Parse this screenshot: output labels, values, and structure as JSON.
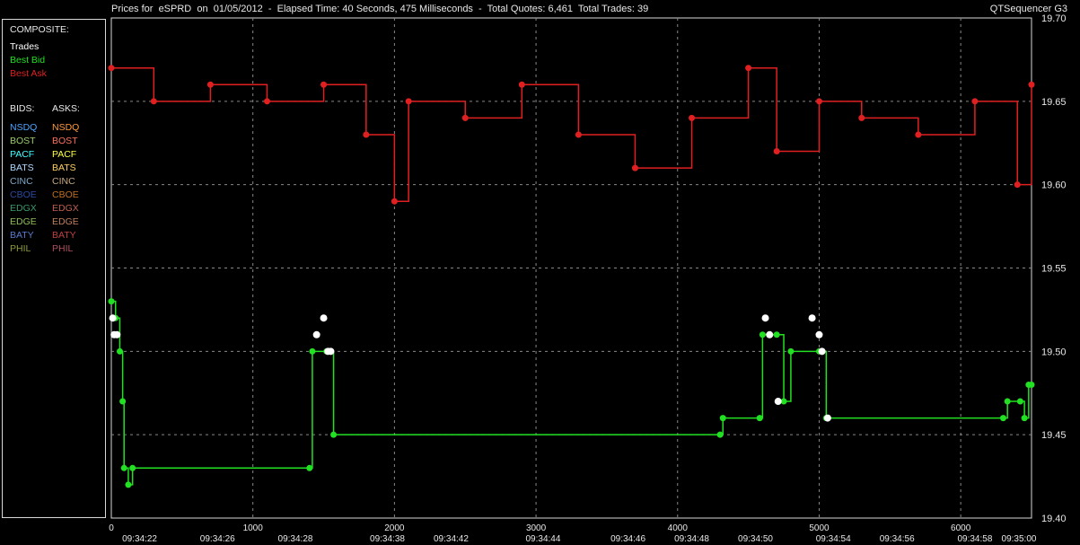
{
  "header": {
    "title": "Prices for  eSPRD  on  01/05/2012  -  Elapsed Time: 40 Seconds, 475 Milliseconds  -  Total Quotes: 6,461  Total Trades: 39",
    "app_name": "QTSequencer G3"
  },
  "legend": {
    "composite_title": "COMPOSITE:",
    "composite_items": [
      {
        "label": "Trades",
        "color": "#ffffff"
      },
      {
        "label": "Best Bid",
        "color": "#22e022"
      },
      {
        "label": "Best Ask",
        "color": "#e02020"
      }
    ],
    "bids_title": "BIDS:",
    "asks_title": "ASKS:",
    "bids": [
      {
        "label": "NSDQ",
        "color": "#4fa3ff"
      },
      {
        "label": "BOST",
        "color": "#9ccc6b"
      },
      {
        "label": "PACF",
        "color": "#40ffff"
      },
      {
        "label": "BATS",
        "color": "#b0d8ff"
      },
      {
        "label": "CINC",
        "color": "#7fa8c8"
      },
      {
        "label": "CBOE",
        "color": "#2a4aa0"
      },
      {
        "label": "EDGX",
        "color": "#3a9a6a"
      },
      {
        "label": "EDGE",
        "color": "#8fbf5a"
      },
      {
        "label": "BATY",
        "color": "#5a7acf"
      },
      {
        "label": "PHIL",
        "color": "#8f9a3a"
      }
    ],
    "asks": [
      {
        "label": "NSDQ",
        "color": "#ff9a3a"
      },
      {
        "label": "BOST",
        "color": "#ff7060"
      },
      {
        "label": "PACF",
        "color": "#ffff40"
      },
      {
        "label": "BATS",
        "color": "#ffd060"
      },
      {
        "label": "CINC",
        "color": "#c8a880"
      },
      {
        "label": "CBOE",
        "color": "#c07020"
      },
      {
        "label": "EDGX",
        "color": "#c06050"
      },
      {
        "label": "EDGE",
        "color": "#c08060"
      },
      {
        "label": "BATY",
        "color": "#c04040"
      },
      {
        "label": "PHIL",
        "color": "#b05060"
      }
    ]
  },
  "chart_data": {
    "type": "line",
    "ylim": [
      19.4,
      19.7
    ],
    "y_ticks": [
      "19.70",
      "19.65",
      "19.60",
      "19.55",
      "19.50",
      "19.45",
      "19.40"
    ],
    "xlim": [
      0,
      6500
    ],
    "x_ticks": [
      0,
      1000,
      2000,
      3000,
      4000,
      5000,
      6000
    ],
    "time_labels": [
      {
        "x": 200,
        "label": "09:34:22"
      },
      {
        "x": 750,
        "label": "09:34:26"
      },
      {
        "x": 1300,
        "label": "09:34:28"
      },
      {
        "x": 1950,
        "label": "09:34:38"
      },
      {
        "x": 2400,
        "label": "09:34:42"
      },
      {
        "x": 3050,
        "label": "09:34:44"
      },
      {
        "x": 3650,
        "label": "09:34:46"
      },
      {
        "x": 4100,
        "label": "09:34:48"
      },
      {
        "x": 4550,
        "label": "09:34:50"
      },
      {
        "x": 5100,
        "label": "09:34:54"
      },
      {
        "x": 5550,
        "label": "09:34:56"
      },
      {
        "x": 6100,
        "label": "09:34:58"
      },
      {
        "x": 6600,
        "label": "09:35:00"
      }
    ],
    "grid": true,
    "series": [
      {
        "name": "Best Bid",
        "color": "#22e022",
        "points": [
          [
            0,
            19.53
          ],
          [
            30,
            19.52
          ],
          [
            60,
            19.5
          ],
          [
            80,
            19.47
          ],
          [
            90,
            19.43
          ],
          [
            120,
            19.42
          ],
          [
            150,
            19.43
          ],
          [
            1400,
            19.43
          ],
          [
            1420,
            19.5
          ],
          [
            1520,
            19.5
          ],
          [
            1570,
            19.45
          ],
          [
            4300,
            19.45
          ],
          [
            4320,
            19.46
          ],
          [
            4580,
            19.46
          ],
          [
            4600,
            19.51
          ],
          [
            4700,
            19.51
          ],
          [
            4750,
            19.47
          ],
          [
            4800,
            19.5
          ],
          [
            5000,
            19.5
          ],
          [
            5050,
            19.46
          ],
          [
            6300,
            19.46
          ],
          [
            6330,
            19.47
          ],
          [
            6420,
            19.47
          ],
          [
            6450,
            19.46
          ],
          [
            6480,
            19.48
          ],
          [
            6500,
            19.48
          ]
        ]
      },
      {
        "name": "Best Ask",
        "color": "#e02020",
        "points": [
          [
            0,
            19.67
          ],
          [
            300,
            19.65
          ],
          [
            700,
            19.66
          ],
          [
            1100,
            19.65
          ],
          [
            1500,
            19.66
          ],
          [
            1800,
            19.63
          ],
          [
            2000,
            19.59
          ],
          [
            2100,
            19.65
          ],
          [
            2500,
            19.64
          ],
          [
            2900,
            19.66
          ],
          [
            3300,
            19.63
          ],
          [
            3700,
            19.61
          ],
          [
            4100,
            19.64
          ],
          [
            4500,
            19.67
          ],
          [
            4700,
            19.62
          ],
          [
            5000,
            19.65
          ],
          [
            5300,
            19.64
          ],
          [
            5700,
            19.63
          ],
          [
            6100,
            19.65
          ],
          [
            6400,
            19.6
          ],
          [
            6500,
            19.66
          ]
        ]
      },
      {
        "name": "Trades",
        "color": "#ffffff",
        "points": [
          [
            10,
            19.52
          ],
          [
            20,
            19.51
          ],
          [
            40,
            19.51
          ],
          [
            1450,
            19.51
          ],
          [
            1500,
            19.52
          ],
          [
            1530,
            19.5
          ],
          [
            1550,
            19.5
          ],
          [
            4620,
            19.52
          ],
          [
            4650,
            19.51
          ],
          [
            4710,
            19.47
          ],
          [
            4950,
            19.52
          ],
          [
            5000,
            19.51
          ],
          [
            5020,
            19.5
          ],
          [
            5060,
            19.46
          ]
        ]
      }
    ]
  }
}
